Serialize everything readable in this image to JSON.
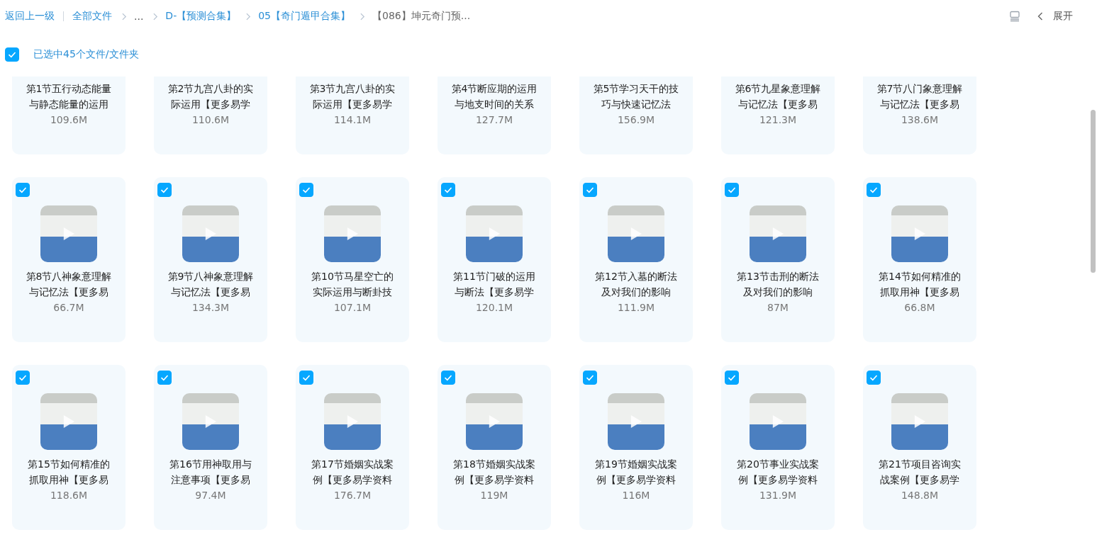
{
  "header": {
    "back_link": "返回上一级",
    "breadcrumbs": [
      {
        "label": "全部文件",
        "kind": "link"
      },
      {
        "label": "...",
        "kind": "ellipsis"
      },
      {
        "label": "D-【预测合集】",
        "kind": "link"
      },
      {
        "label": "05【奇门遁甲合集】",
        "kind": "link"
      },
      {
        "label": "【086】坤元奇门预...",
        "kind": "current"
      }
    ],
    "expand_label": "展开"
  },
  "selection": {
    "checked": true,
    "label": "已选中45个文件/文件夹"
  },
  "partial_row": [
    {
      "title": "第1节五行动态能量与静态能量的运用",
      "size": "109.6M"
    },
    {
      "title": "第2节九宫八卦的实际运用【更多易学",
      "size": "110.6M"
    },
    {
      "title": "第3节九宫八卦的实际运用【更多易学",
      "size": "114.1M"
    },
    {
      "title": "第4节断应期的运用与地支时间的关系",
      "size": "127.7M"
    },
    {
      "title": "第5节学习天干的技巧与快速记忆法",
      "size": "156.9M"
    },
    {
      "title": "第6节九星象意理解与记忆法【更多易",
      "size": "121.3M"
    },
    {
      "title": "第7节八门象意理解与记忆法【更多易",
      "size": "138.6M"
    }
  ],
  "files": [
    {
      "title": "第8节八神象意理解与记忆法【更多易",
      "size": "66.7M",
      "checked": true
    },
    {
      "title": "第9节八神象意理解与记忆法【更多易",
      "size": "134.3M",
      "checked": true
    },
    {
      "title": "第10节马星空亡的实际运用与断卦技",
      "size": "107.1M",
      "checked": true
    },
    {
      "title": "第11节门破的运用与断法【更多易学",
      "size": "120.1M",
      "checked": true
    },
    {
      "title": "第12节入墓的断法及对我们的影响",
      "size": "111.9M",
      "checked": true
    },
    {
      "title": "第13节击刑的断法及对我们的影响",
      "size": "87M",
      "checked": true
    },
    {
      "title": "第14节如何精准的抓取用神【更多易",
      "size": "66.8M",
      "checked": true
    },
    {
      "title": "第15节如何精准的抓取用神【更多易",
      "size": "118.6M",
      "checked": true
    },
    {
      "title": "第16节用神取用与注意事项【更多易",
      "size": "97.4M",
      "checked": true
    },
    {
      "title": "第17节婚姻实战案例【更多易学资料",
      "size": "176.7M",
      "checked": true
    },
    {
      "title": "第18节婚姻实战案例【更多易学资料",
      "size": "119M",
      "checked": true
    },
    {
      "title": "第19节婚姻实战案例【更多易学资料",
      "size": "116M",
      "checked": true
    },
    {
      "title": "第20节事业实战案例【更多易学资料",
      "size": "131.9M",
      "checked": true
    },
    {
      "title": "第21节项目咨询实战案例【更多易学",
      "size": "148.8M",
      "checked": true
    }
  ]
}
